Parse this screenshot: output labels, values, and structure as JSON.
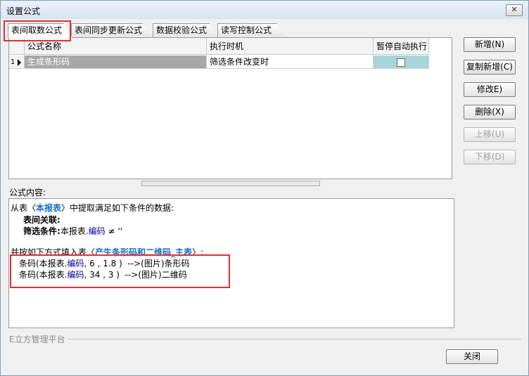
{
  "window": {
    "title": "设置公式",
    "close_glyph": "✕"
  },
  "tabs": [
    "表间取数公式",
    "表间同步更新公式",
    "数据校验公式",
    "读写控制公式"
  ],
  "grid": {
    "columns": [
      "公式名称",
      "执行时机",
      "暂停自动执行"
    ],
    "rows": [
      {
        "index": "1",
        "name": "生成条形码",
        "timing": "筛选条件改变时",
        "paused": false
      }
    ]
  },
  "buttons": {
    "new": "新增(N)",
    "copy_new": "复制新增(C)",
    "modify": "修改E)",
    "delete": "删除(X)",
    "move_up": "上移(U)",
    "move_down": "下移(D)",
    "close": "关闭"
  },
  "content": {
    "label": "公式内容:",
    "l1_a": "从表〈",
    "l1_b": "本报表",
    "l1_c": "〉中提取满足如下条件的数据:",
    "l2": "表间关联:",
    "l3_a": "筛选条件:",
    "l3_b": "本报表.",
    "l3_c": "编码",
    "l3_d": " ≠ ''",
    "l5_a": "并按如下方式填入表〈",
    "l5_b": "产生条形码和二维码_主表",
    "l5_c": "〉:",
    "l6_a": "条码(本报表.",
    "l6_b": "编码",
    "l6_c": ", 6 , 1.8 )  -->(图片)条形码",
    "l7_a": "条码(本报表.",
    "l7_b": "编码",
    "l7_c": ", 34 , 3 )  -->(图片)二维码"
  },
  "footer": {
    "platform": "E立方管理平台"
  }
}
